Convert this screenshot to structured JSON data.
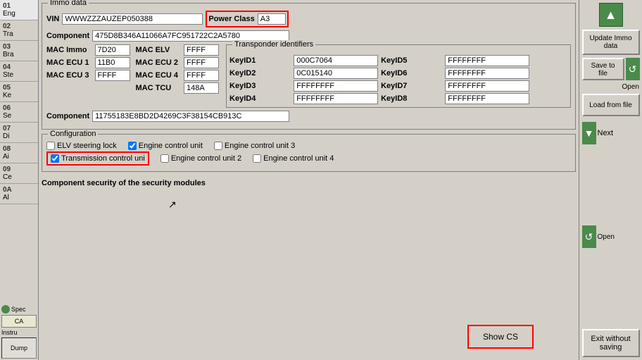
{
  "sidebar": {
    "items": [
      {
        "num": "01",
        "label": "Eng"
      },
      {
        "num": "02",
        "label": "Tra"
      },
      {
        "num": "03",
        "label": "Bra"
      },
      {
        "num": "04",
        "label": "Ste"
      },
      {
        "num": "05",
        "label": "Ke"
      },
      {
        "num": "06",
        "label": "Se"
      },
      {
        "num": "07",
        "label": "Di"
      },
      {
        "num": "08",
        "label": "Ai"
      },
      {
        "num": "09",
        "label": "Ce"
      },
      {
        "num": "0A",
        "label": "Al"
      }
    ],
    "bottom_items": [
      "Spec",
      "CA",
      "Instru",
      "Dump"
    ]
  },
  "immo": {
    "group_title": "Immo data",
    "vin_label": "VIN",
    "vin_value": "WWWZZZAUZEP050388",
    "power_class_label": "Power Class",
    "power_class_value": "A3",
    "component_label": "Component",
    "component_value1": "475D8B346A11066A7FC951722C2A5780",
    "mac_immo_label": "MAC Immo",
    "mac_immo_value": "7D20",
    "mac_elv_label": "MAC ELV",
    "mac_elv_value": "FFFF",
    "mac_ecu1_label": "MAC ECU 1",
    "mac_ecu1_value": "11B0",
    "mac_ecu2_label": "MAC ECU 2",
    "mac_ecu2_value": "FFFF",
    "mac_ecu3_label": "MAC ECU 3",
    "mac_ecu3_value": "FFFF",
    "mac_ecu4_label": "MAC ECU 4",
    "mac_ecu4_value": "FFFF",
    "mac_tcu_label": "MAC TCU",
    "mac_tcu_value": "148A",
    "component_value2": "11755183E8BD2D4269C3F38154CB913C"
  },
  "transponder": {
    "group_title": "Transponder identifiers",
    "keyid1_label": "KeyID1",
    "keyid1_value": "000C7064",
    "keyid5_label": "KeyID5",
    "keyid5_value": "FFFFFFFF",
    "keyid2_label": "KeyID2",
    "keyid2_value": "0C015140",
    "keyid6_label": "KeyID6",
    "keyid6_value": "FFFFFFFF",
    "keyid3_label": "KeyID3",
    "keyid3_value": "FFFFFFFF",
    "keyid7_label": "KeyID7",
    "keyid7_value": "FFFFFFFF",
    "keyid4_label": "KeyID4",
    "keyid4_value": "FFFFFFFF",
    "keyid8_label": "KeyID8",
    "keyid8_value": "FFFFFFFF"
  },
  "configuration": {
    "group_title": "Configuration",
    "elv_label": "ELV steering lock",
    "elv_checked": false,
    "engine_cu_label": "Engine control unit",
    "engine_cu_checked": true,
    "engine_cu3_label": "Engine control unit 3",
    "engine_cu3_checked": false,
    "transmission_label": "Transmission control uni",
    "transmission_checked": true,
    "engine_cu2_label": "Engine control unit 2",
    "engine_cu2_checked": false,
    "engine_cu4_label": "Engine control unit 4",
    "engine_cu4_checked": false
  },
  "security": {
    "label": "Component security of the security modules"
  },
  "buttons": {
    "update_immo": "Update Immo data",
    "save_to_file": "Save to file",
    "load_from_file": "Load from file",
    "next": "Next",
    "open1": "Open",
    "open2": "Open",
    "show_cs": "Show CS",
    "exit_without_saving": "Exit without saving"
  }
}
